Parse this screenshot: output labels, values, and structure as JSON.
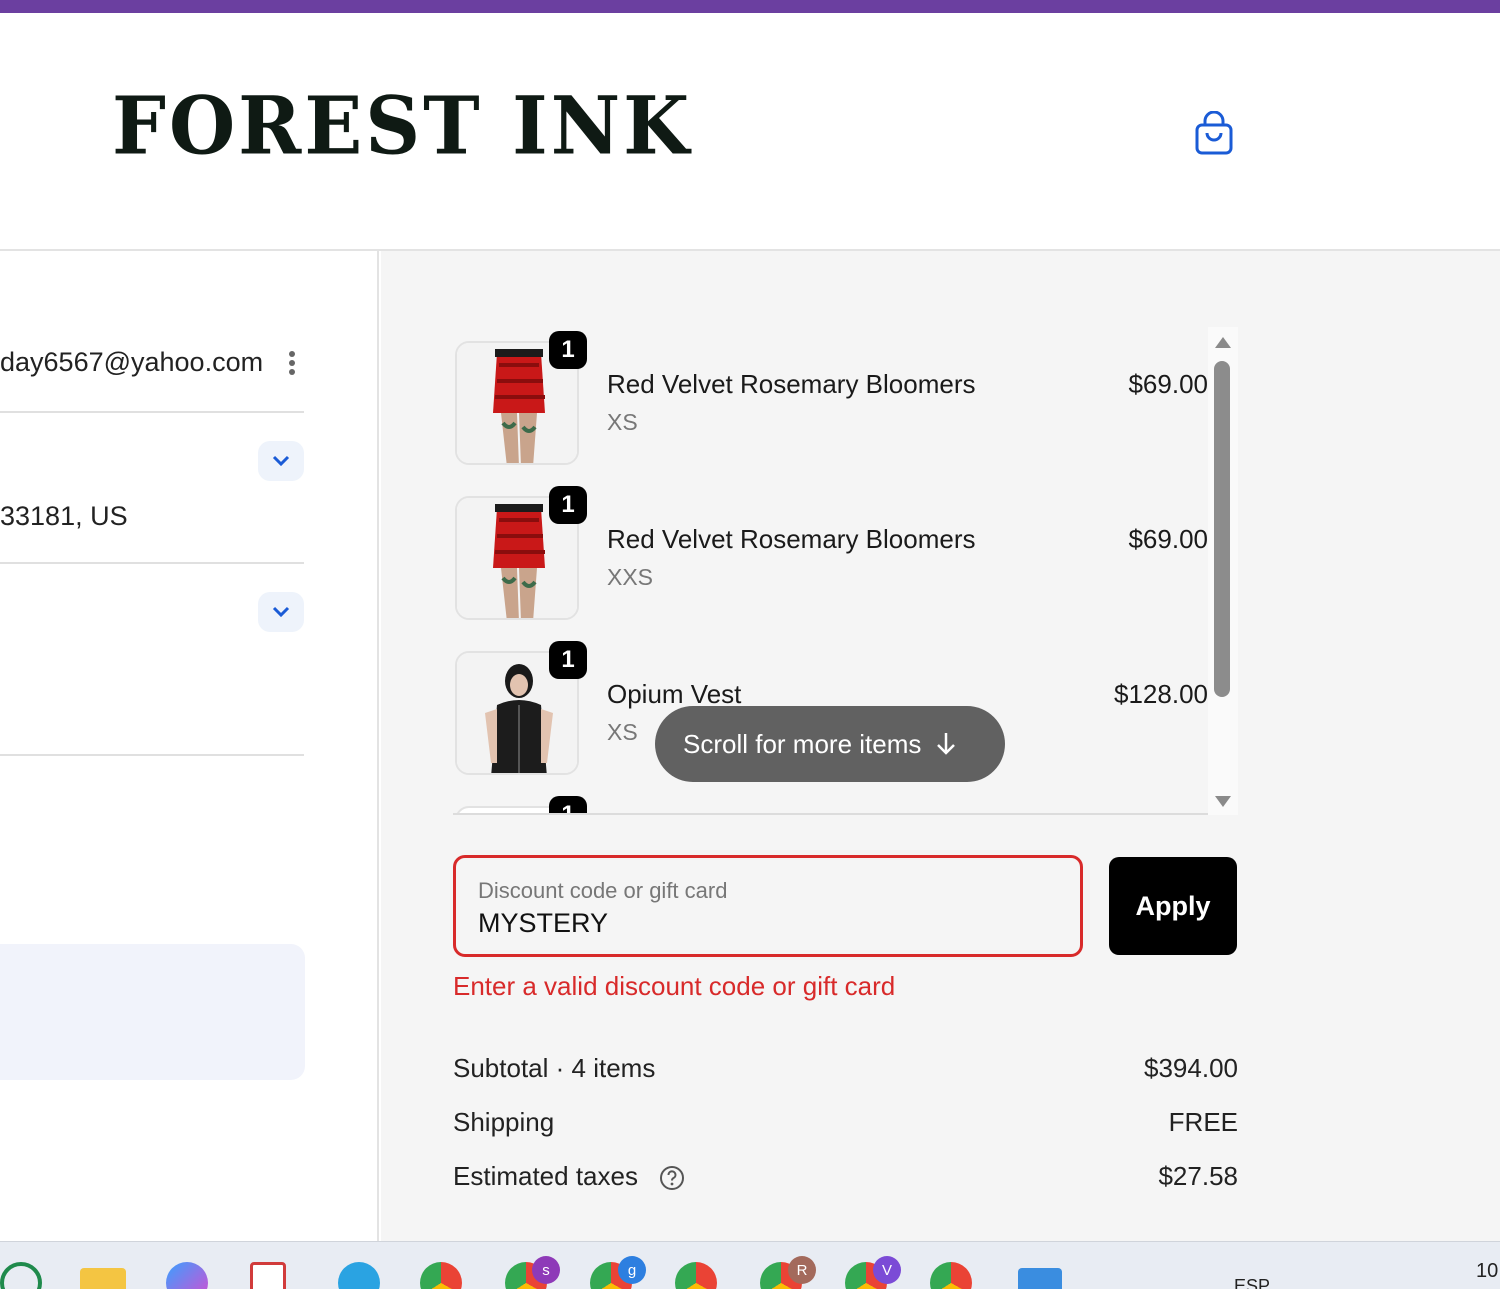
{
  "store": {
    "logo_text": "FOREST INK",
    "accent_bar_color": "#6b3fa0"
  },
  "header": {
    "cart_icon": "shopping-bag-icon"
  },
  "left": {
    "email": "day6567@yahoo.com",
    "address": "33181, US"
  },
  "items": [
    {
      "name": "Red Velvet Rosemary Bloomers",
      "variant": "XS",
      "price": "$69.00",
      "qty": "1",
      "image": "red-bloomers"
    },
    {
      "name": "Red Velvet Rosemary Bloomers",
      "variant": "XXS",
      "price": "$69.00",
      "qty": "1",
      "image": "red-bloomers"
    },
    {
      "name": "Opium Vest",
      "variant": "XS",
      "price": "$128.00",
      "qty": "1",
      "image": "black-vest"
    },
    {
      "name": "",
      "variant": "",
      "price": "",
      "qty": "1",
      "image": "partial"
    }
  ],
  "scroll_hint": "Scroll for more items",
  "discount": {
    "label": "Discount code or gift card",
    "value": "MYSTERY",
    "apply_label": "Apply",
    "error": "Enter a valid discount code or gift card",
    "error_color": "#d82a2a"
  },
  "summary": {
    "subtotal_label": "Subtotal · 4 items",
    "subtotal_value": "$394.00",
    "shipping_label": "Shipping",
    "shipping_value": "FREE",
    "taxes_label": "Estimated taxes",
    "taxes_value": "$27.58"
  },
  "taskbar": {
    "badges": [
      "s",
      "g",
      "R",
      "V"
    ],
    "lang": "ESP",
    "clock": "10"
  }
}
